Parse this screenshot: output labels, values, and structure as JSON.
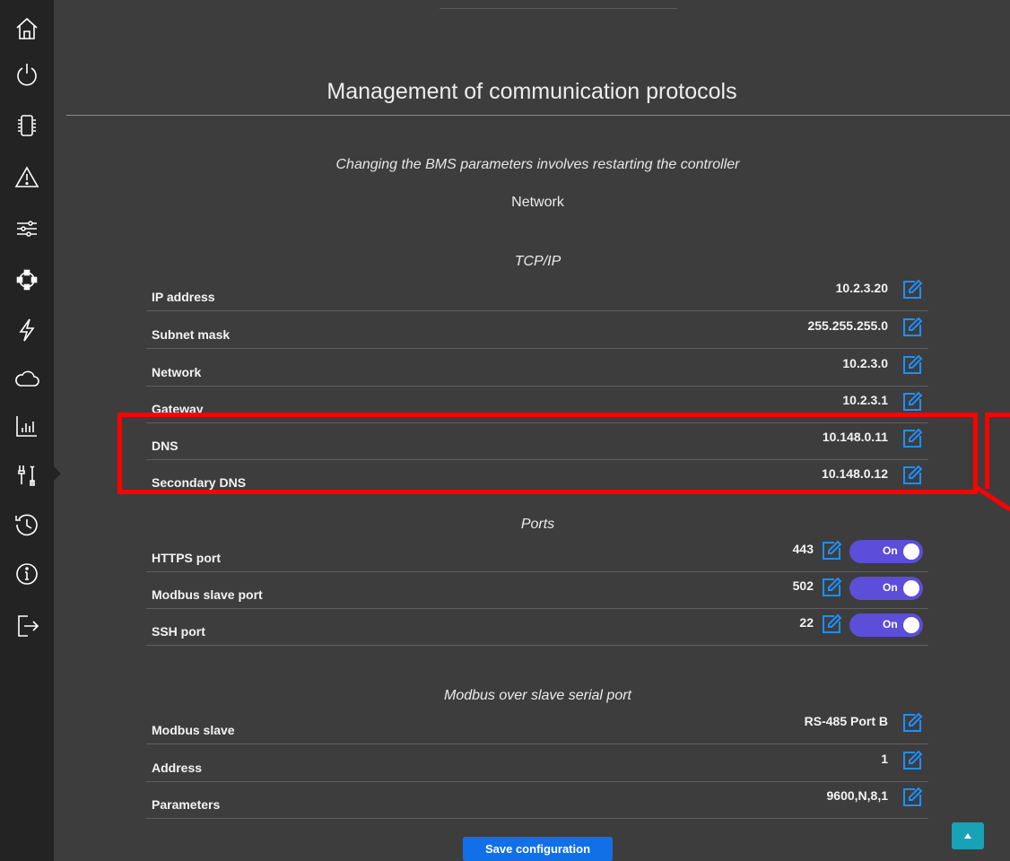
{
  "sidebar": {
    "items": [
      {
        "icon": "home-icon"
      },
      {
        "icon": "power-icon"
      },
      {
        "icon": "device-icon"
      },
      {
        "icon": "alert-triangle-icon"
      },
      {
        "icon": "sliders-icon"
      },
      {
        "icon": "network-nodes-icon"
      },
      {
        "icon": "lightning-icon"
      },
      {
        "icon": "cloud-icon"
      },
      {
        "icon": "bar-chart-icon"
      },
      {
        "icon": "tools-icon",
        "active": true
      },
      {
        "icon": "history-icon"
      },
      {
        "icon": "info-icon"
      },
      {
        "icon": "logout-icon"
      }
    ]
  },
  "page": {
    "title": "Management of communication protocols",
    "notice": "Changing the BMS parameters involves restarting the controller",
    "network_heading": "Network"
  },
  "tcpip": {
    "heading": "TCP/IP",
    "rows": [
      {
        "label": "IP address",
        "value": "10.2.3.20"
      },
      {
        "label": "Subnet mask",
        "value": "255.255.255.0"
      },
      {
        "label": "Network",
        "value": "10.2.3.0"
      },
      {
        "label": "Gateway",
        "value": "10.2.3.1"
      },
      {
        "label": "DNS",
        "value": "10.148.0.11"
      },
      {
        "label": "Secondary DNS",
        "value": "10.148.0.12"
      }
    ]
  },
  "ports": {
    "heading": "Ports",
    "rows": [
      {
        "label": "HTTPS port",
        "value": "443",
        "toggle": "On"
      },
      {
        "label": "Modbus slave port",
        "value": "502",
        "toggle": "On"
      },
      {
        "label": "SSH port",
        "value": "22",
        "toggle": "On"
      }
    ]
  },
  "serial": {
    "heading": "Modbus over slave serial port",
    "rows": [
      {
        "label": "Modbus slave",
        "value": "RS-485 Port B"
      },
      {
        "label": "Address",
        "value": "1"
      },
      {
        "label": "Parameters",
        "value": "9600,N,8,1"
      }
    ]
  },
  "actions": {
    "save_label": "Save configuration"
  },
  "colors": {
    "background": "#3d3d3d",
    "sidebar": "#232323",
    "edit_icon": "#1e8fff",
    "toggle_on": "#5c4ed8",
    "save_button": "#1170e8",
    "scroll_top": "#17a2b8",
    "highlight": "#ff0000"
  }
}
